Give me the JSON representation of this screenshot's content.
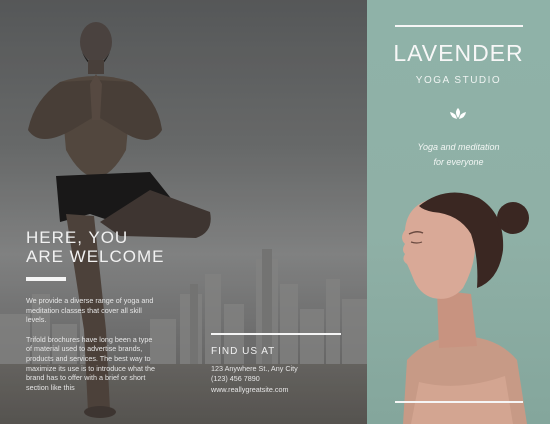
{
  "welcome": {
    "line1": "HERE, YOU",
    "line2": "ARE WELCOME"
  },
  "description": {
    "para1": "We provide a diverse range of yoga and meditation classes that cover all skill levels.",
    "para2": "Trifold brochures have long been a type of material used to advertise brands, products and services. The best way to maximize its use is to introduce what the brand has to offer with a brief or short section like this"
  },
  "contact": {
    "title": "FIND US AT",
    "address": "123 Anywhere St., Any City",
    "phone": "(123) 456 7890",
    "website": "www.reallygreatsite.com"
  },
  "brand": {
    "name": "LAVENDER",
    "subtitle": "YOGA STUDIO",
    "tagline_line1": "Yoga and meditation",
    "tagline_line2": "for everyone"
  },
  "icons": {
    "logo": "lotus-leaves-icon"
  },
  "colors": {
    "panel_teal": "#8fb2a8",
    "text_light": "#f5f5f5"
  }
}
